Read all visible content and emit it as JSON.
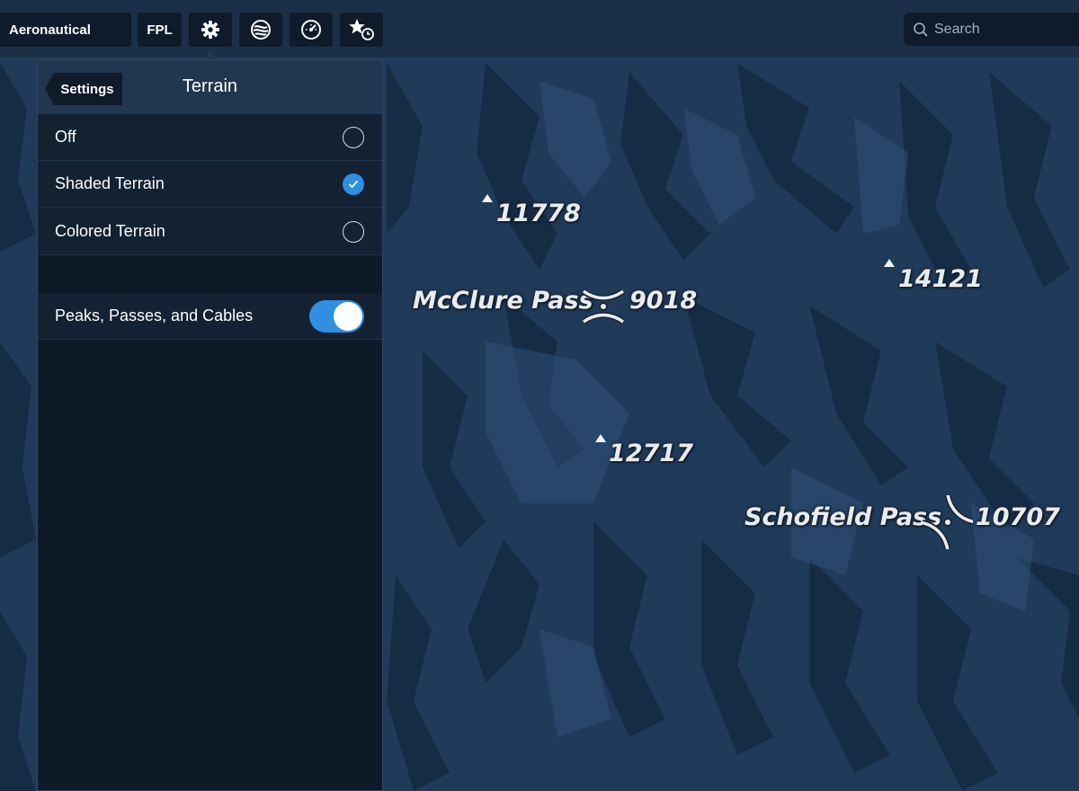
{
  "toolbar": {
    "aeronautical_label": "Aeronautical",
    "fpl_label": "FPL",
    "settings_icon": "gear-icon",
    "layers_icon": "layers-icon",
    "gauge_icon": "gauge-icon",
    "favorites_icon": "star-clock-icon"
  },
  "search": {
    "placeholder": "Search"
  },
  "panel": {
    "back_label": "Settings",
    "title": "Terrain",
    "options": [
      {
        "label": "Off",
        "selected": false
      },
      {
        "label": "Shaded Terrain",
        "selected": true
      },
      {
        "label": "Colored Terrain",
        "selected": false
      }
    ],
    "toggle": {
      "label": "Peaks, Passes, and Cables",
      "on": true
    }
  },
  "map": {
    "peaks": [
      "11778",
      "14121",
      "12717"
    ],
    "passes": [
      {
        "name": "McClure Pass",
        "elevation": "9018"
      },
      {
        "name": "Schofield Pass",
        "elevation": "10707"
      }
    ]
  },
  "colors": {
    "accent": "#2f8fe0",
    "panel_bg": "#0f1a28",
    "map_base": "#203b5a"
  }
}
